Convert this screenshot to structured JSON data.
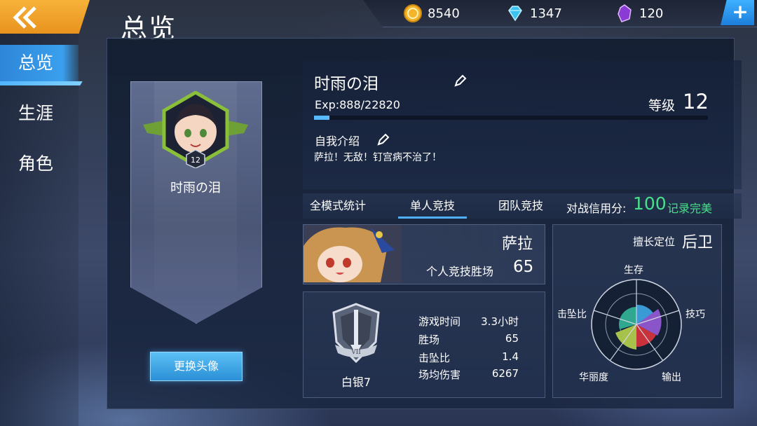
{
  "header": {
    "title": "总览"
  },
  "sidebar": {
    "items": [
      {
        "label": "总览",
        "active": true
      },
      {
        "label": "生涯",
        "active": false
      },
      {
        "label": "角色",
        "active": false
      }
    ]
  },
  "currency": {
    "gold": "8540",
    "diamond": "1347",
    "crystal": "120"
  },
  "avatar": {
    "level": "12",
    "name": "时雨の泪",
    "change_button": "更换头像"
  },
  "profile": {
    "name": "时雨の泪",
    "exp_text": "Exp:888/22820",
    "exp_fraction": 0.039,
    "level_label": "等级",
    "level": "12",
    "intro_label": "自我介绍",
    "intro_text": "萨拉！无敌！钉宫病不治了！"
  },
  "tabs": [
    {
      "label": "全模式统计",
      "active": false
    },
    {
      "label": "单人竞技",
      "active": true
    },
    {
      "label": "团队竞技",
      "active": false
    }
  ],
  "rating": {
    "label": "对战信用分:",
    "value": "100",
    "note": "记录完美"
  },
  "hero": {
    "name": "萨拉",
    "wins_label": "个人竞技胜场",
    "wins": "65"
  },
  "rank": {
    "name": "白银7",
    "stats": [
      {
        "label": "游戏时间",
        "value": "3.3小时"
      },
      {
        "label": "胜场",
        "value": "65"
      },
      {
        "label": "击坠比",
        "value": "1.4"
      },
      {
        "label": "场均伤害",
        "value": "6267"
      }
    ]
  },
  "position": {
    "label": "擅长定位",
    "value": "后卫",
    "axes": [
      "生存",
      "技巧",
      "输出",
      "华丽度",
      "击坠比"
    ],
    "axis_colors": [
      "#3a9ad6",
      "#8a55c8",
      "#c8323a",
      "#a7c24a",
      "#2fa88f"
    ]
  },
  "colors": {
    "accent": "#3aa0ee",
    "back_button": "#f0a22a",
    "rating_green": "#48e08a"
  }
}
